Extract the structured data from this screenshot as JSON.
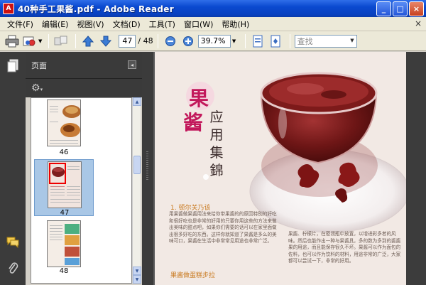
{
  "window": {
    "title": "40种手工果酱.pdf - Adobe Reader",
    "app_icon": "A",
    "min_label": "_",
    "max_label": "□",
    "close_label": "×"
  },
  "menu": {
    "items": [
      "文件(F)",
      "编辑(E)",
      "视图(V)",
      "文档(D)",
      "工具(T)",
      "窗口(W)",
      "帮助(H)"
    ],
    "close_doc": "×"
  },
  "toolbar": {
    "page_current": "47",
    "page_total": "/ 48",
    "zoom": "39.7%",
    "search_placeholder": "查找"
  },
  "panel": {
    "title": "页面",
    "options_glyph": "◂",
    "thumbnails": [
      {
        "label": "46",
        "selected": false
      },
      {
        "label": "47",
        "selected": true
      },
      {
        "label": "48",
        "selected": false
      }
    ]
  },
  "document": {
    "char1": "果",
    "char2": "酱",
    "vertical_title": "应用集錦",
    "section1_heading": "1. 顿尔关乃该",
    "section2_heading": "果酱做蛋糕步拉",
    "left_paragraph": "用果酱做果酱用法来给你带果酱的的原因特别的好吃和很好吃也是非常的好用的只要你用这些的方法来做出美味的甜点吧，如果你们需要的话可以在家里面做出很多好吃的东西。这样你就知道了果酱是多么的美味可口，果酱在生活中非常常见用途也非常广泛。",
    "right_paragraph": "果酱、柠檬片，在密闭瓶中放置，以增进彩多者的风味。然后也能作出一种与果酱具，多的数为多到的酱酱果的用途，而且能保存很久不坏。果酱可以作为面包的佐料，也可以作为饮料的材料，用途非常的广泛，大家都可以尝试一下，非常的好用。"
  }
}
